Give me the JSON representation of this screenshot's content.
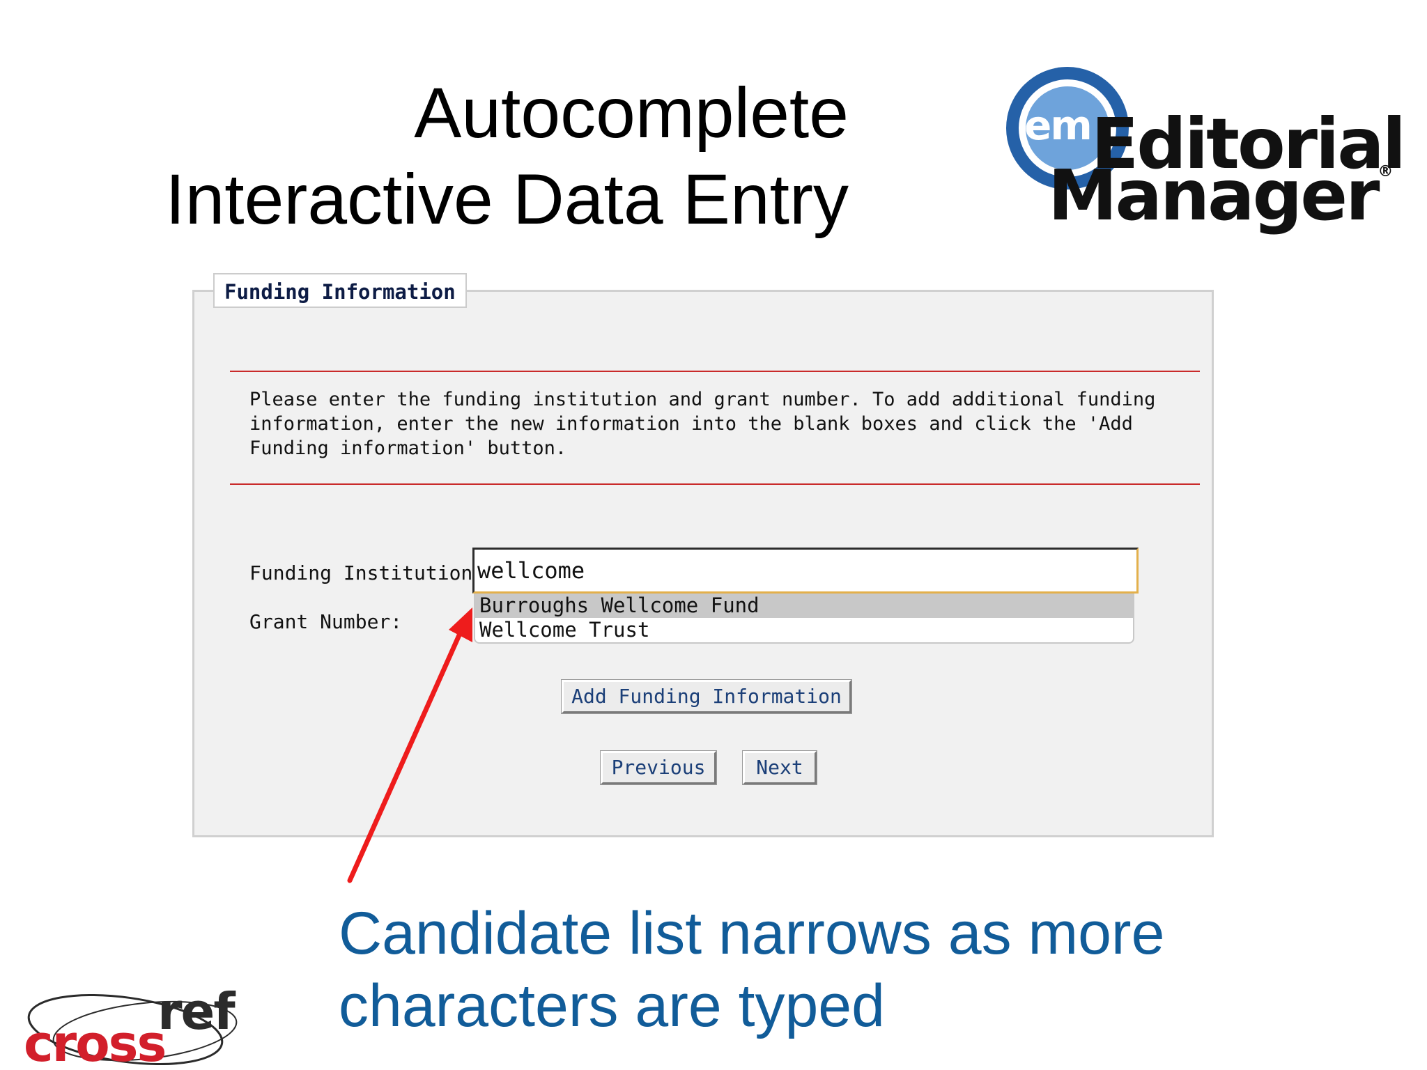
{
  "slide": {
    "title_line1": "Autocomplete",
    "title_line2": "Interactive Data Entry",
    "caption_line1": "Candidate list narrows as more",
    "caption_line2": "characters are typed"
  },
  "logos": {
    "editorial_manager": {
      "badge": "em",
      "word1": "Editorial",
      "word2": "Manager",
      "registered": "®"
    },
    "crossref": {
      "part1": "cross",
      "part2": "ref"
    }
  },
  "form": {
    "section_title": "Funding Information",
    "instructions": "Please enter the funding institution and grant number. To add additional funding information, enter the new information into the blank boxes and click the 'Add Funding information' button.",
    "institution_label": "Funding Institution:",
    "institution_value": "wellcome",
    "grant_label": "Grant Number:",
    "suggestions": [
      "Burroughs Wellcome Fund",
      "Wellcome Trust"
    ],
    "add_button": "Add Funding Information",
    "previous_button": "Previous",
    "next_button": "Next"
  },
  "colors": {
    "caption": "#115c99",
    "arrow": "#ee1c1c",
    "rule": "#c92a2a",
    "crossref_red": "#d21f2b",
    "em_blue": "#2561a8"
  },
  "icons": {
    "annotation": "red-arrow-icon"
  }
}
